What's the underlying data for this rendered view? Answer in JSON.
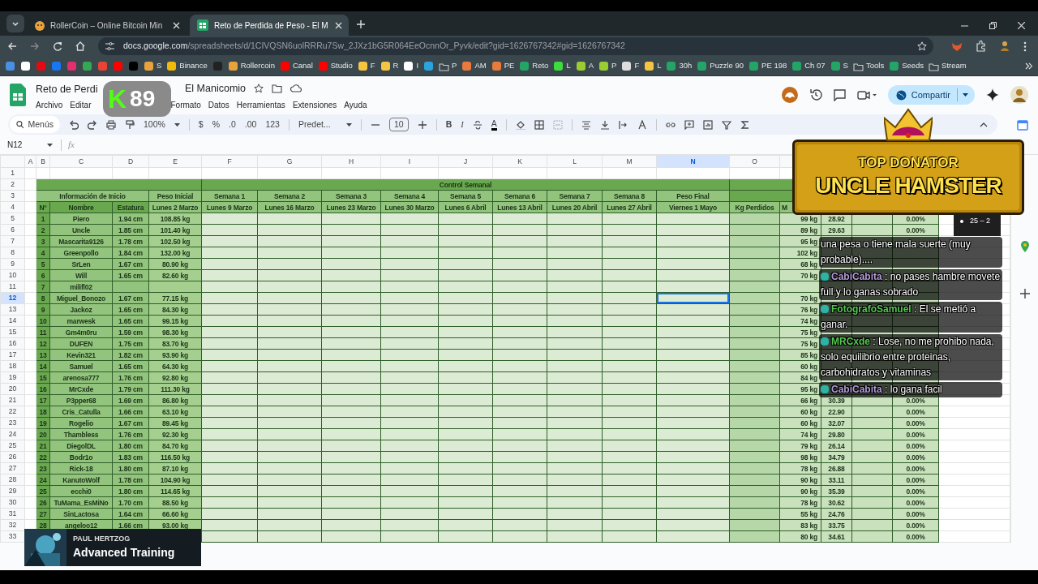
{
  "browser": {
    "tabs": [
      {
        "title": "RollerCoin – Online Bitcoin Min",
        "kind": "hamster",
        "selected": false
      },
      {
        "title": "Reto de Perdida de Peso - El M",
        "kind": "sheets",
        "selected": true
      }
    ],
    "url_host": "docs.google.com",
    "url_path": "/spreadsheets/d/1CIVQSN6uolRRRu7Sw_2JXz1bG5R064EeOcnnOr_Pyvk/edit?gid=1626767342#gid=1626767342",
    "bookmarks": [
      {
        "kind": "icon",
        "color": "#4a90e2"
      },
      {
        "kind": "icon",
        "color": "#ffffff"
      },
      {
        "kind": "icon",
        "color": "#e50914"
      },
      {
        "kind": "icon",
        "color": "#1877f2"
      },
      {
        "kind": "icon",
        "color": "#e1306c"
      },
      {
        "kind": "icon",
        "color": "#34a853"
      },
      {
        "kind": "icon",
        "color": "#ea4335"
      },
      {
        "kind": "icon",
        "color": "#ff0000"
      },
      {
        "kind": "icon",
        "color": "#000000"
      },
      {
        "kind": "labeled",
        "label": "S",
        "color": "#e8a33c"
      },
      {
        "kind": "labeled",
        "label": "Binance",
        "color": "#f0b90b"
      },
      {
        "kind": "icon",
        "color": "#222222"
      },
      {
        "kind": "labeled",
        "label": "Rollercoin",
        "color": "#e8a33c"
      },
      {
        "kind": "labeled",
        "label": "Canal",
        "color": "#ff0000"
      },
      {
        "kind": "labeled",
        "label": "Studio",
        "color": "#ff0000"
      },
      {
        "kind": "labeled",
        "label": "F",
        "color": "#f5c542"
      },
      {
        "kind": "labeled",
        "label": "R",
        "color": "#f5c542"
      },
      {
        "kind": "labeled",
        "label": "I",
        "color": "#ffffff"
      },
      {
        "kind": "icon",
        "color": "#2aa3df"
      },
      {
        "kind": "folder",
        "label": "P"
      },
      {
        "kind": "labeled",
        "label": "AM",
        "color": "#e87a3c"
      },
      {
        "kind": "labeled",
        "label": "PE",
        "color": "#e87a3c"
      },
      {
        "kind": "labeled",
        "label": "Reto",
        "color": "#23a566"
      },
      {
        "kind": "labeled",
        "label": "L",
        "color": "#3ddc3d"
      },
      {
        "kind": "labeled",
        "label": "A",
        "color": "#9acd32"
      },
      {
        "kind": "labeled",
        "label": "P",
        "color": "#9acd32"
      },
      {
        "kind": "labeled",
        "label": "F",
        "color": "#dddddd"
      },
      {
        "kind": "labeled",
        "label": "L",
        "color": "#f5c542"
      },
      {
        "kind": "labeled",
        "label": "30h",
        "color": "#23a566"
      },
      {
        "kind": "labeled",
        "label": "Puzzle 90",
        "color": "#23a566"
      },
      {
        "kind": "labeled",
        "label": "PE 198",
        "color": "#23a566"
      },
      {
        "kind": "labeled",
        "label": "Ch 07",
        "color": "#23a566"
      },
      {
        "kind": "labeled",
        "label": "S",
        "color": "#23a566"
      },
      {
        "kind": "folder",
        "label": "Tools"
      },
      {
        "kind": "labeled",
        "label": "Seeds",
        "color": "#23a566"
      },
      {
        "kind": "folder",
        "label": "Stream"
      }
    ]
  },
  "document": {
    "title_parts": [
      "Reto de Perdi",
      "El Manicomio"
    ],
    "menu_left": [
      "Archivo",
      "Editar"
    ],
    "menu_right": [
      "Formato",
      "Datos",
      "Herramientas",
      "Extensiones",
      "Ayuda"
    ],
    "share": "Compartir"
  },
  "toolbar": {
    "search_placeholder": "Menús",
    "zoom": "100%",
    "currency": "$",
    "percent": "%",
    "dec_less": ".0",
    "dec_more": ".00",
    "more_formats": "123",
    "font": "Predet...",
    "font_size": "10",
    "bold": "B",
    "italic": "I",
    "text_color": "A"
  },
  "formula_bar": {
    "name_box": "N12",
    "fx": "fx"
  },
  "sheet": {
    "columns": [
      {
        "label": "A",
        "selected": false
      },
      {
        "label": "B",
        "selected": false
      },
      {
        "label": "C",
        "selected": false
      },
      {
        "label": "D",
        "selected": false
      },
      {
        "label": "E",
        "selected": false
      },
      {
        "label": "F",
        "selected": false
      },
      {
        "label": "G",
        "selected": false
      },
      {
        "label": "H",
        "selected": false
      },
      {
        "label": "I",
        "selected": false
      },
      {
        "label": "J",
        "selected": false
      },
      {
        "label": "K",
        "selected": false
      },
      {
        "label": "L",
        "selected": false
      },
      {
        "label": "M",
        "selected": false
      },
      {
        "label": "N",
        "selected": true
      },
      {
        "label": "O",
        "selected": false
      }
    ],
    "row_numbers": [
      {
        "label": "1",
        "selected": false
      },
      {
        "label": "2",
        "selected": false
      },
      {
        "label": "3",
        "selected": false
      },
      {
        "label": "4",
        "selected": false
      },
      {
        "label": "5",
        "selected": false
      },
      {
        "label": "6",
        "selected": false
      },
      {
        "label": "7",
        "selected": false
      },
      {
        "label": "8",
        "selected": false
      },
      {
        "label": "9",
        "selected": false
      },
      {
        "label": "10",
        "selected": false
      },
      {
        "label": "11",
        "selected": false
      },
      {
        "label": "12",
        "selected": true
      },
      {
        "label": "13",
        "selected": false
      },
      {
        "label": "14",
        "selected": false
      },
      {
        "label": "15",
        "selected": false
      },
      {
        "label": "16",
        "selected": false
      },
      {
        "label": "17",
        "selected": false
      },
      {
        "label": "18",
        "selected": false
      },
      {
        "label": "19",
        "selected": false
      },
      {
        "label": "20",
        "selected": false
      },
      {
        "label": "21",
        "selected": false
      },
      {
        "label": "22",
        "selected": false
      },
      {
        "label": "23",
        "selected": false
      },
      {
        "label": "24",
        "selected": false
      },
      {
        "label": "25",
        "selected": false
      },
      {
        "label": "26",
        "selected": false
      },
      {
        "label": "27",
        "selected": false
      },
      {
        "label": "28",
        "selected": false
      },
      {
        "label": "29",
        "selected": false
      },
      {
        "label": "30",
        "selected": false
      },
      {
        "label": "31",
        "selected": false
      },
      {
        "label": "32",
        "selected": false
      },
      {
        "label": "33",
        "selected": false
      }
    ],
    "banner": "Control Semanal",
    "group_headers": {
      "info": "Información de Inicio",
      "initial": "Peso Inicial",
      "weeks": [
        "Semana 1",
        "Semana 2",
        "Semana 3",
        "Semana 4",
        "Semana 5",
        "Semana 6",
        "Semana 7",
        "Semana 8"
      ],
      "final": "Peso Final"
    },
    "column_headers": {
      "num": "N°",
      "name": "Nombre",
      "height": "Estatura",
      "initial_date": "Lunes 2 Marzo",
      "week_dates": [
        "Lunes 9 Marzo",
        "Lunes 16 Marzo",
        "Lunes 23 Marzo",
        "Lunes 30 Marzo",
        "Lunes 6 Abril",
        "Lunes 13 Abril",
        "Lunes 20 Abril",
        "Lunes 27 Abril"
      ],
      "final_date": "Viernes 1 Mayo",
      "lost": "Kg Perdidos",
      "column_p": "M"
    },
    "participants": [
      {
        "num": "1",
        "name": "Piero",
        "height": "1.94 cm",
        "weight": "108.85 kg",
        "column_p": "99 kg",
        "column_q": "28.92",
        "column_s": "0.00%"
      },
      {
        "num": "2",
        "name": "Uncle",
        "height": "1.85 cm",
        "weight": "101.40 kg",
        "column_p": "89 kg",
        "column_q": "29.63",
        "column_s": "0.00%"
      },
      {
        "num": "3",
        "name": "Mascarita9126",
        "height": "1.78 cm",
        "weight": "102.50 kg",
        "column_p": "95 kg"
      },
      {
        "num": "4",
        "name": "Greenpollo",
        "height": "1.84 cm",
        "weight": "132.00 kg",
        "column_p": "102 kg"
      },
      {
        "num": "5",
        "name": "SrLen",
        "height": "1.67 cm",
        "weight": "80.90 kg",
        "column_p": "68 kg"
      },
      {
        "num": "6",
        "name": "Will",
        "height": "1.65 cm",
        "weight": "82.60 kg",
        "column_p": "70 kg"
      },
      {
        "num": "7",
        "name": "milifl02"
      },
      {
        "num": "8",
        "name": "Miguel_Bonozo",
        "height": "1.67 cm",
        "weight": "77.15 kg",
        "column_p": "70 kg"
      },
      {
        "num": "9",
        "name": "Jackoz",
        "height": "1.65 cm",
        "weight": "84.30 kg",
        "column_p": "76 kg"
      },
      {
        "num": "10",
        "name": "marwesk",
        "height": "1.65 cm",
        "weight": "99.15 kg",
        "column_p": "74 kg"
      },
      {
        "num": "11",
        "name": "Gm4m0ru",
        "height": "1.59 cm",
        "weight": "98.30 kg",
        "column_p": "75 kg"
      },
      {
        "num": "12",
        "name": "DUFEN",
        "height": "1.75 cm",
        "weight": "83.70 kg",
        "column_p": "75 kg"
      },
      {
        "num": "13",
        "name": "Kevin321",
        "height": "1.82 cm",
        "weight": "93.90 kg",
        "column_p": "85 kg"
      },
      {
        "num": "14",
        "name": "Samuel",
        "height": "1.65 cm",
        "weight": "64.30 kg",
        "column_p": "60 kg"
      },
      {
        "num": "15",
        "name": "arenosa777",
        "height": "1.76 cm",
        "weight": "92.80 kg",
        "column_p": "84 kg"
      },
      {
        "num": "16",
        "name": "MrCxde",
        "height": "1.79 cm",
        "weight": "111.30 kg",
        "column_p": "95 kg"
      },
      {
        "num": "17",
        "name": "P3pper68",
        "height": "1.69 cm",
        "weight": "86.80 kg",
        "column_p": "66 kg",
        "column_q": "30.39",
        "column_s": "0.00%"
      },
      {
        "num": "18",
        "name": "Cris_Catulla",
        "height": "1.66 cm",
        "weight": "63.10 kg",
        "column_p": "60 kg",
        "column_q": "22.90",
        "column_s": "0.00%"
      },
      {
        "num": "19",
        "name": "Rogelio",
        "height": "1.67 cm",
        "weight": "89.45 kg",
        "column_p": "60 kg",
        "column_q": "32.07",
        "column_s": "0.00%"
      },
      {
        "num": "20",
        "name": "Thambless",
        "height": "1.76 cm",
        "weight": "92.30 kg",
        "column_p": "74 kg",
        "column_q": "29.80",
        "column_s": "0.00%"
      },
      {
        "num": "21",
        "name": "DiegolDL",
        "height": "1.80 cm",
        "weight": "84.70 kg",
        "column_p": "79 kg",
        "column_q": "26.14",
        "column_s": "0.00%"
      },
      {
        "num": "22",
        "name": "Bodr1o",
        "height": "1.83 cm",
        "weight": "116.50 kg",
        "column_p": "98 kg",
        "column_q": "34.79",
        "column_s": "0.00%"
      },
      {
        "num": "23",
        "name": "Rick-18",
        "height": "1.80 cm",
        "weight": "87.10 kg",
        "column_p": "78 kg",
        "column_q": "26.88",
        "column_s": "0.00%"
      },
      {
        "num": "24",
        "name": "KanutoWolf",
        "height": "1.78 cm",
        "weight": "104.90 kg",
        "column_p": "90 kg",
        "column_q": "33.11",
        "column_s": "0.00%"
      },
      {
        "num": "25",
        "name": "ecchi0",
        "height": "1.80 cm",
        "weight": "114.65 kg",
        "column_p": "90 kg",
        "column_q": "35.39",
        "column_s": "0.00%"
      },
      {
        "num": "26",
        "name": "TuMama_EsMiNo",
        "height": "1.70 cm",
        "weight": "88.50 kg",
        "column_p": "78 kg",
        "column_q": "30.62",
        "column_s": "0.00%"
      },
      {
        "num": "27",
        "name": "SinLactosa",
        "height": "1.64 cm",
        "weight": "66.60 kg",
        "column_p": "55 kg",
        "column_q": "24.76",
        "column_s": "0.00%"
      },
      {
        "num": "28",
        "name": "angeloo12",
        "height": "1.66 cm",
        "weight": "93.00 kg",
        "column_p": "83 kg",
        "column_q": "33.75",
        "column_s": "0.00%"
      },
      {
        "column_p": "80 kg",
        "column_q": "34.61",
        "column_s": "0.00%"
      }
    ]
  },
  "stream_overlay": {
    "viewer_badge": {
      "logo": "K",
      "count": "89"
    },
    "donator": {
      "title": "TOP DONATOR",
      "name": "UNCLE HAMSTER"
    },
    "tooltip": "25 – 2",
    "chat": [
      {
        "text": "una pesa o tiene mala suerte (muy probable)...."
      },
      {
        "user": "CabiCabita",
        "color": "#b49ad8",
        "separator": ":",
        "text": "no pases hambre movete full y lo ganas sobrado"
      },
      {
        "user": "FotografoSamuel",
        "color": "#55c94f",
        "separator": ":",
        "text": "El se metió a ganar."
      },
      {
        "user": "MRCxde",
        "color": "#55c94f",
        "separator": ":",
        "text": "Lose, no me prohibo nada, solo equilibrio entre proteinas, carbohidratos y vitaminas"
      },
      {
        "user": "CabiCabita",
        "color": "#b49ad8",
        "separator": ":",
        "text": "lo gana facil"
      }
    ],
    "ad": {
      "name": "PAUL HERTZOG",
      "title": "Advanced Training"
    }
  }
}
